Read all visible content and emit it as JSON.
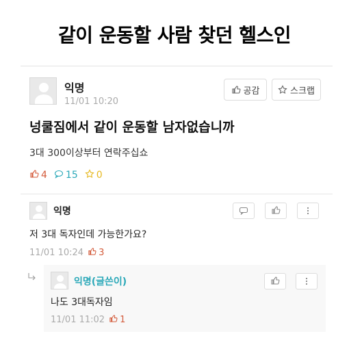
{
  "headline": "같이 운동할 사람 찾던 헬스인",
  "post": {
    "author": "익명",
    "datetime": "11/01 10:20",
    "empathy_label": "공감",
    "scrap_label": "스크랩",
    "title": "넝쿨짐에서 같이 운동할 남자없습니까",
    "body": "3대 300이상부터 연락주십쇼",
    "stats": {
      "likes": "4",
      "comments": "15",
      "scraps": "0"
    }
  },
  "comments": [
    {
      "author": "익명",
      "text": "저 3대 독자인데 가능한가요?",
      "datetime": "11/01 10:24",
      "likes": "3"
    }
  ],
  "reply": {
    "author": "익명(글쓴이)",
    "text": "나도 3대독자임",
    "datetime": "11/01 11:02",
    "likes": "1"
  },
  "colors": {
    "like": "#d35a3a",
    "comment": "#2aa8b8",
    "scrap": "#e6b820",
    "op_author": "#2aa8b8",
    "meta": "#aaaaaa"
  }
}
